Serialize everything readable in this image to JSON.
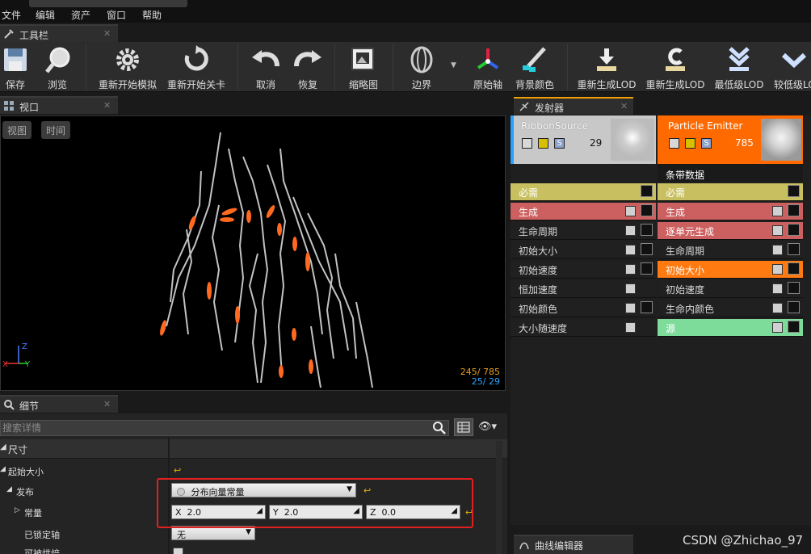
{
  "menu": [
    "文件",
    "编辑",
    "资产",
    "窗口",
    "帮助"
  ],
  "toolbar": {
    "tab_title": "工具栏",
    "buttons": [
      {
        "label": "保存",
        "icon": "save-icon"
      },
      {
        "label": "浏览",
        "icon": "browse-icon"
      },
      {
        "label": "重新开始模拟",
        "icon": "restart-sim-icon"
      },
      {
        "label": "重新开始关卡",
        "icon": "restart-level-icon"
      },
      {
        "label": "取消",
        "icon": "undo-icon"
      },
      {
        "label": "恢复",
        "icon": "redo-icon"
      },
      {
        "label": "缩略图",
        "icon": "thumbnail-icon"
      },
      {
        "label": "边界",
        "icon": "bounds-icon"
      },
      {
        "label": "原始轴",
        "icon": "origin-axis-icon"
      },
      {
        "label": "背景颜色",
        "icon": "bg-color-icon"
      },
      {
        "label": "重新生成LOD",
        "icon": "regen-lod-icon"
      },
      {
        "label": "重新生成LOD",
        "icon": "regen-lod-icon"
      },
      {
        "label": "最低级LOD",
        "icon": "lowest-lod-icon"
      },
      {
        "label": "较低级LOD",
        "icon": "lower-lod-icon"
      }
    ]
  },
  "viewport": {
    "tab_title": "视口",
    "btn_view": "视图",
    "btn_time": "时间",
    "stats_1": "245/ 785",
    "stats_2": "25/  29",
    "axis_z": "Z",
    "axis_x": "X",
    "axis_y": "Y"
  },
  "details": {
    "tab_title": "细节",
    "search_placeholder": "搜索详情",
    "category": "尺寸",
    "rows": {
      "start_size": "起始大小",
      "distribution": "发布",
      "constant": "常量",
      "locked_axes": "已锁定轴",
      "can_be_baked": "可被烘焙"
    },
    "distribution_value": "分布向量常量",
    "x_label": "X",
    "x_value": "2.0",
    "y_label": "Y",
    "y_value": "2.0",
    "z_label": "Z",
    "z_value": "0.0",
    "locked_axes_value": "无"
  },
  "emitters": {
    "tab_title": "发射器",
    "left": {
      "name": "RibbonSource",
      "count": "29",
      "modules": [
        "必需",
        "生成",
        "生命周期",
        "初始大小",
        "初始速度",
        "恒加速度",
        "初始颜色",
        "大小随速度"
      ]
    },
    "right": {
      "name": "Particle Emitter",
      "count": "785",
      "type_data": "条带数据",
      "modules": [
        "必需",
        "生成",
        "逐单元生成",
        "生命周期",
        "初始大小",
        "初始速度",
        "生命内颜色",
        "源"
      ]
    }
  },
  "curve_editor": {
    "tab_title": "曲线编辑器"
  },
  "watermark": "CSDN @Zhichao_97",
  "colors": {
    "left_header": "#c8c8c8",
    "right_header": "#ff6a00",
    "required": "#c8c060",
    "spawn": "#cc5f5f",
    "selected": "#ff7a10",
    "source": "#7edc9a",
    "highlight_box": "#e02020"
  }
}
